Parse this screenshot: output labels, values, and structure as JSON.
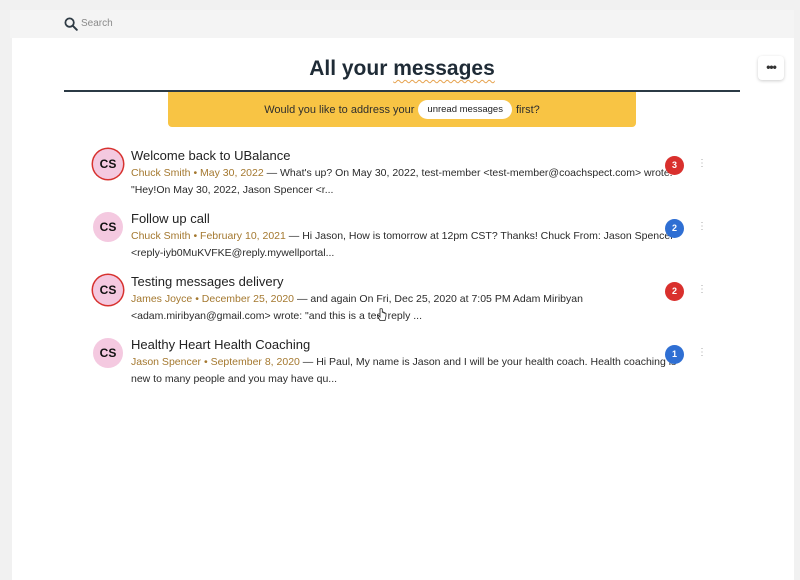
{
  "search": {
    "placeholder": "Search"
  },
  "header": {
    "title_prefix": "All your ",
    "title_underlined": "messages",
    "more_label": "•••"
  },
  "banner": {
    "prefix": "Would you like to address your",
    "pill": "unread messages",
    "suffix": "first?"
  },
  "messages": [
    {
      "initials": "CS",
      "unread": true,
      "title": "Welcome back to UBalance",
      "author": "Chuck Smith",
      "date": "May 30, 2022",
      "excerpt_line1": " — What's up? On May 30, 2022, test-member <test-member@coachspect.com> wrote:",
      "excerpt_line2": "\"Hey!On May 30, 2022, Jason Spencer <r...",
      "badge": "3",
      "badge_color": "#d9302d"
    },
    {
      "initials": "CS",
      "unread": false,
      "title": "Follow up call",
      "author": "Chuck Smith",
      "date": "February 10, 2021",
      "excerpt_line1": " — Hi Jason,  How is tomorrow at 12pm CST? Thanks! Chuck From: Jason Spencer",
      "excerpt_line2": "<reply-iyb0MuKVFKE@reply.mywellportal...",
      "badge": "2",
      "badge_color": "#2f6fd3"
    },
    {
      "initials": "CS",
      "unread": true,
      "title": "Testing messages delivery",
      "author": "James Joyce",
      "date": "December 25, 2020",
      "excerpt_line1": " — and again On Fri, Dec 25, 2020 at 7:05 PM Adam Miribyan",
      "excerpt_line2": "<adam.miribyan@gmail.com> wrote: \"and this is a test reply ...",
      "badge": "2",
      "badge_color": "#d9302d"
    },
    {
      "initials": "CS",
      "unread": false,
      "title": "Healthy Heart Health Coaching",
      "author": "Jason Spencer",
      "date": "September 8, 2020",
      "excerpt_line1": " — Hi Paul, My name is Jason and I will be your health coach. Health coaching is",
      "excerpt_line2": "new to many people and you may have qu...",
      "badge": "1",
      "badge_color": "#2f6fd3"
    }
  ],
  "meta_separator": " • ",
  "kebab_label": "⋮"
}
